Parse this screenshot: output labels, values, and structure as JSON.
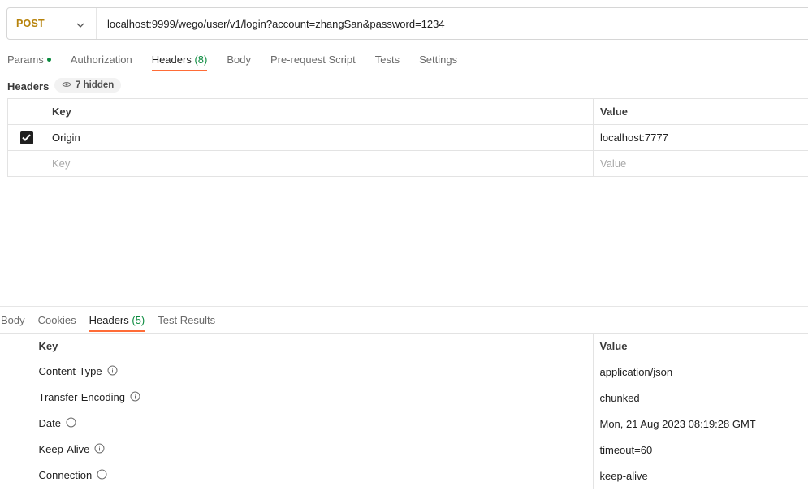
{
  "request": {
    "method": "POST",
    "url": "localhost:9999/wego/user/v1/login?account=zhangSan&password=1234"
  },
  "request_tabs": [
    {
      "label": "Params",
      "dot": true
    },
    {
      "label": "Authorization"
    },
    {
      "label": "Headers",
      "count": "(8)",
      "active": true
    },
    {
      "label": "Body"
    },
    {
      "label": "Pre-request Script"
    },
    {
      "label": "Tests"
    },
    {
      "label": "Settings"
    }
  ],
  "headers_section": {
    "label": "Headers",
    "hidden_label": "7 hidden"
  },
  "request_headers": {
    "key_header": "Key",
    "value_header": "Value",
    "rows": [
      {
        "key": "Origin",
        "value": "localhost:7777",
        "checked": true
      }
    ],
    "placeholder_key": "Key",
    "placeholder_value": "Value"
  },
  "response_tabs": [
    {
      "label": "Body"
    },
    {
      "label": "Cookies"
    },
    {
      "label": "Headers",
      "count": "(5)",
      "active": true
    },
    {
      "label": "Test Results"
    }
  ],
  "response_headers": {
    "key_header": "Key",
    "value_header": "Value",
    "rows": [
      {
        "key": "Content-Type",
        "value": "application/json"
      },
      {
        "key": "Transfer-Encoding",
        "value": "chunked"
      },
      {
        "key": "Date",
        "value": "Mon, 21 Aug 2023 08:19:28 GMT"
      },
      {
        "key": "Keep-Alive",
        "value": "timeout=60"
      },
      {
        "key": "Connection",
        "value": "keep-alive"
      }
    ]
  },
  "colors": {
    "method": "#b7830c",
    "accent": "#ff6c37",
    "count": "#0a8a3e"
  }
}
